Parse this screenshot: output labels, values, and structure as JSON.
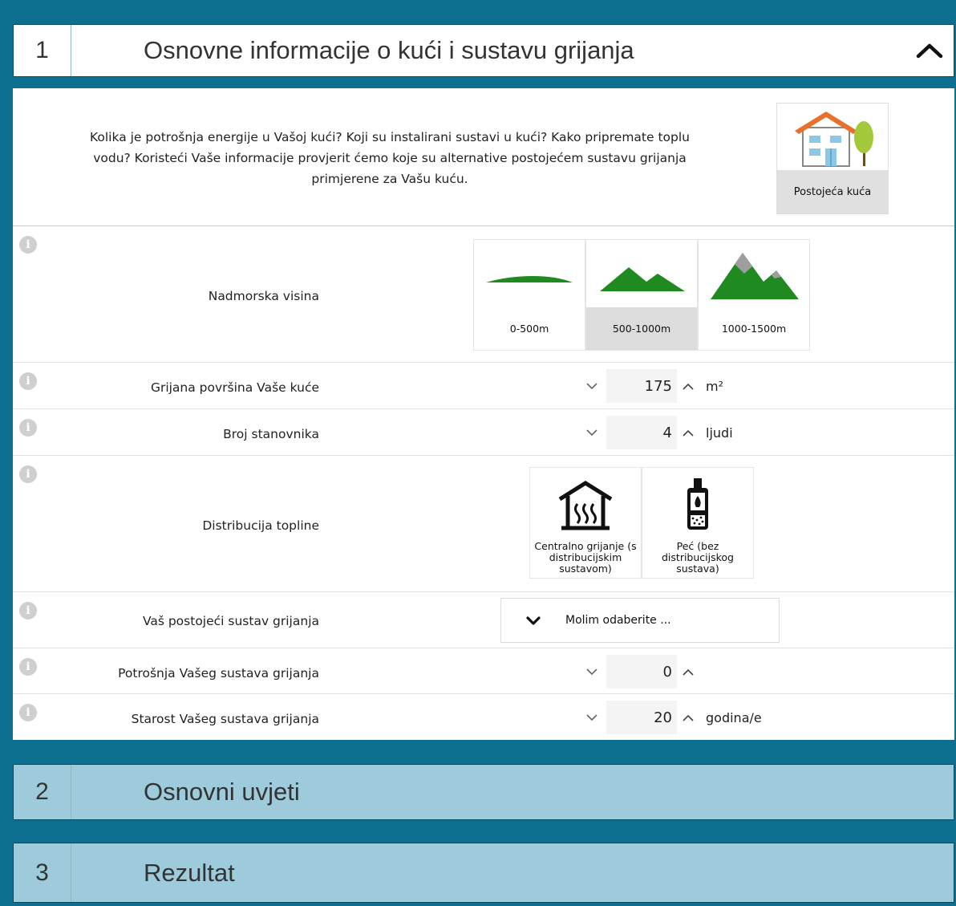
{
  "sections": [
    {
      "number": "1",
      "title": "Osnovne informacije o kući i sustavu grijanja"
    },
    {
      "number": "2",
      "title": "Osnovni uvjeti"
    },
    {
      "number": "3",
      "title": "Rezultat"
    }
  ],
  "intro": {
    "text": "Kolika je potrošnja energije u Vašoj kući? Koji su instalirani sustavi u kući? Kako pripremate toplu vodu? Koristeći Vaše informacije provjerit ćemo koje su alternative postojećem sustavu grijanja primjerene za Vašu kuću.",
    "house_label": "Postojeća kuća"
  },
  "info_glyph": "i",
  "altitude": {
    "label": "Nadmorska visina",
    "options": [
      "0-500m",
      "500-1000m",
      "1000-1500m"
    ],
    "selected": "500-1000m"
  },
  "area": {
    "label": "Grijana površina Vaše kuće",
    "value": "175",
    "unit": "m²"
  },
  "residents": {
    "label": "Broj stanovnika",
    "value": "4",
    "unit": "ljudi"
  },
  "distribution": {
    "label": "Distribucija topline",
    "options": [
      "Centralno grijanje (s distribucijskim sustavom)",
      "Peć (bez distribucijskog sustava)"
    ]
  },
  "system": {
    "label": "Vaš postojeći sustav grijanja",
    "placeholder": "Molim odaberite ..."
  },
  "consumption": {
    "label": "Potrošnja Vašeg sustava grijanja",
    "value": "0"
  },
  "age": {
    "label": "Starost Vašeg sustava grijanja",
    "value": "20",
    "unit": "godina/e"
  },
  "colors": {
    "page_bg": "#0c6f8f",
    "collapsed_header": "#9dcbdb",
    "mountain_green": "#1f8a1f",
    "snow_gray": "#9e9e9e",
    "roof_orange": "#e8702a",
    "window_blue": "#8cc7e6",
    "tree_green": "#a3c93a"
  }
}
